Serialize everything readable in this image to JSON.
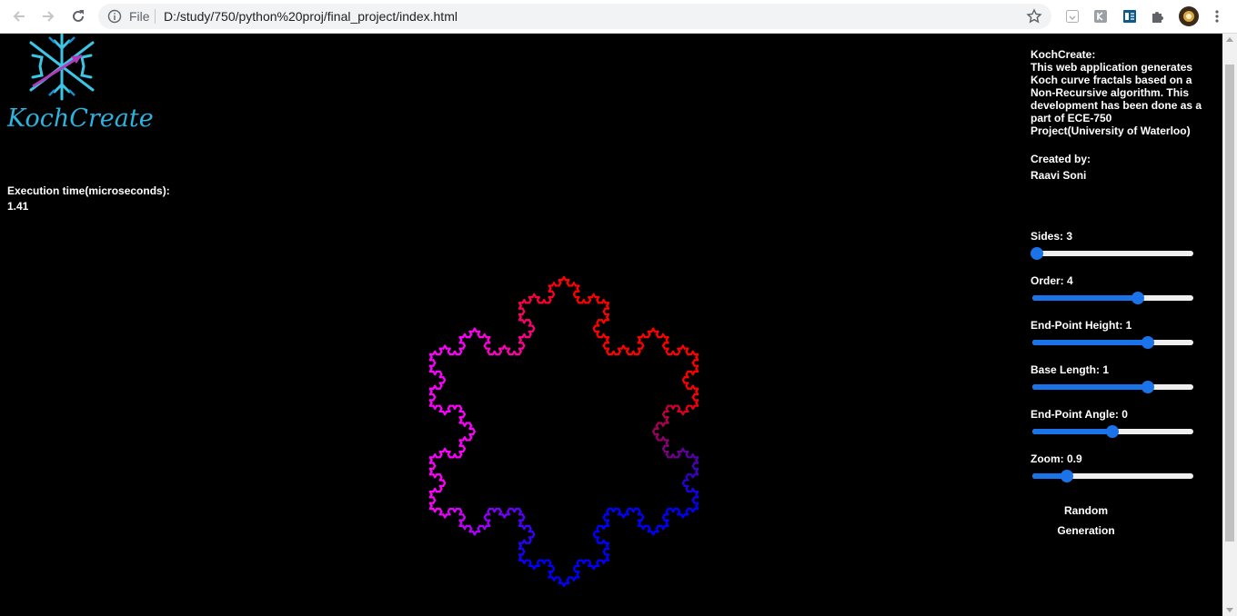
{
  "browser": {
    "scheme_label": "File",
    "url": "D:/study/750/python%20proj/final_project/index.html"
  },
  "logo": {
    "text": "KochCreate"
  },
  "execution": {
    "label": "Execution time(microseconds):",
    "value": "1.41"
  },
  "about": {
    "title": "KochCreate:",
    "lines": [
      "This web application generates",
      "Koch curve fractals based on a",
      "Non-Recursive algorithm. This",
      "development has been done as a",
      "part of ECE-750",
      "Project(University of Waterloo)"
    ],
    "created_label": "Created by:",
    "created_name": "Raavi Soni"
  },
  "controls": [
    {
      "label": "Sides: 3",
      "fraction": 0.0
    },
    {
      "label": "Order: 4",
      "fraction": 0.67
    },
    {
      "label": "End-Point Height: 1",
      "fraction": 0.74
    },
    {
      "label": "Base Length: 1",
      "fraction": 0.74
    },
    {
      "label": "End-Point Angle: 0",
      "fraction": 0.5
    },
    {
      "label": "Zoom: 0.9",
      "fraction": 0.2
    }
  ],
  "random_button": "Random Generation",
  "fractal": {
    "sides": 3,
    "order": 4,
    "colors": [
      "#ff0000",
      "#0000ff",
      "#ff00ff"
    ]
  }
}
